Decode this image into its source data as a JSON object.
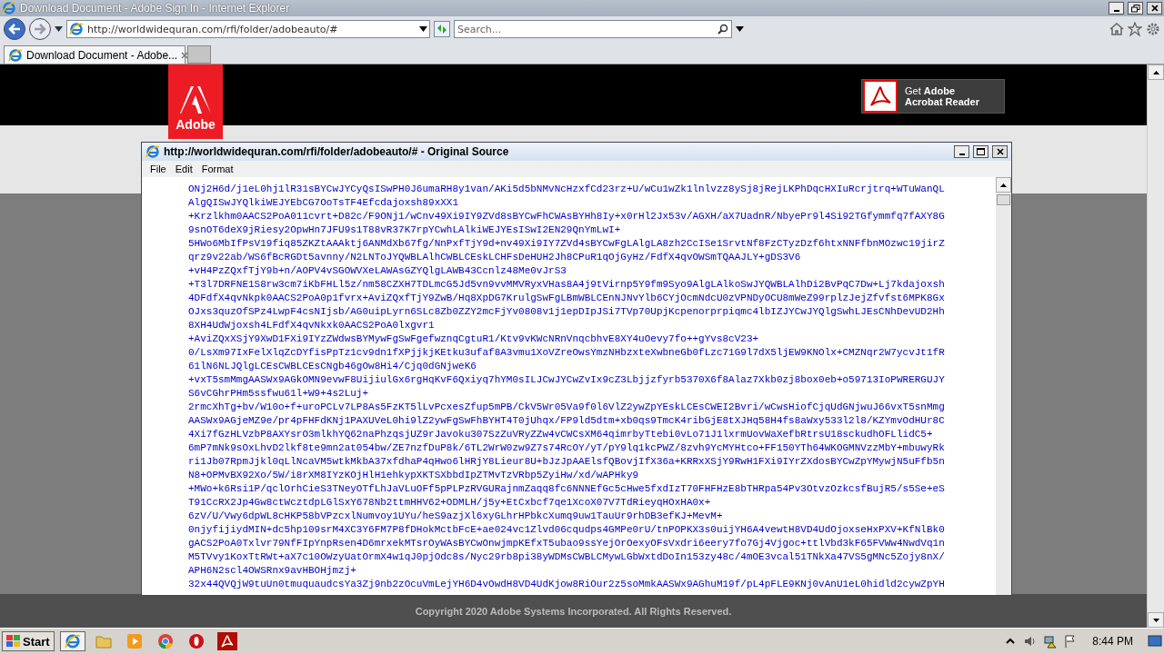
{
  "browser": {
    "title": "Download Document - Adobe Sign In - Internet Explorer",
    "address": "http://worldwidequran.com/rfi/folder/adobeauto/#",
    "search_placeholder": "Search...",
    "tabs": [
      {
        "label": "Download Document - Adobe...",
        "selected": true
      }
    ]
  },
  "page": {
    "logo": "Adobe",
    "reader_button": {
      "line1": "Get **Adobe**",
      "line2": "Acrobat Reader"
    },
    "copyright": "Copyright 2020 Adobe Systems Incorporated. All Rights Reserved."
  },
  "source_window": {
    "title": "http://worldwidequran.com/rfi/folder/adobeauto/# - Original Source",
    "menu": [
      "File",
      "Edit",
      "Format"
    ],
    "lines": [
      "ONj2H6d/j1eL0hj1lR31sBYCwJYCyQsISwPH0J6umaRH8y1van/AKi5d5bNMvNcHzxfCd23rz+U/wCu1wZk1lnlvzz8ySj8jRejLKPhDqcHXIuRcrjtrq+WTuWanQL",
      "AlgQISwJYQlkiWEJYEbCG7OoTsTF4Efcdajoxsh89xXX1",
      "+Krzlkhm0AACS2PoA011cvrt+D82c/F9ONj1/wCnv49Xi9IY9ZVd8sBYCwFhCWAsBYHh8Iy+x0rHl2Jx53v/AGXH/aX7UadnR/NbyePr9l4Si92TGfymmfq7fAXY8G",
      "9snOT6deX9jRiesy2OpwHn7JFU9s1T88vR37K7rpYCwhLAlkiWEJYEsISwI2EN29QnYmLwI+",
      "5HWo6MbIfPsV19fiq85ZKZtAAAktj6ANMdXb67fg/NnPxfTjY9d+nv49Xi9IY7ZVd4sBYCwFgLAlgLA8zh2CcISe1SrvtNf8FzCTyzDzf6htxNNFfbnMOzwc19jirZ",
      "qrz9v22ab/WS6fBcRGDt5avnny/N2LNToJYQWBLAlhCWBLCEskLCHFsDeHUH2Jh8CPuR1qOjGyHz/FdfX4qvOWSmTQAAJLY+gDS3V6",
      "+vH4PzZQxfTjY9b+n/AOPV4vSGOWVXeLAWAsGZYQlgLAWB43Ccnlz48Me0vJrS3",
      "+T3l7DRFNE1S8rw3cm7iKbFHLl5z/nm58CZXH7TDLmcG5Jd5vn9vvMMVRyxVHas8A4j9tVirnp5Y9fm9Syo9AlgLAlkoSwJYQWBLAlhDi2BvPqC7Dw+Lj7kdajoxsh",
      "4DFdfX4qvNkpk0AACS2PoA0p1fvrx+AviZQxfTjY9ZwB/Hq8XpDG7KrulgSwFgLBmWBLCEnNJNvYlb6CYjOcmNdcU0zVPNDyOCU8mWeZ99rplzJejZfvfst6MPK8Gx",
      "OJxs3quzOfSPz4LwpF4csNIjsb/AG0uipLyrn6SLc8Zb0ZZY2mcFjYv0808v1j1epDIpJSi7TVp70UpjKcpenorprpiqmc4lbIZJYCwJYQlgSwhLJEsCNhDevUD2Hh",
      "8XH4UdWjoxsh4LFdfX4qvNkxk0AACS2PoA0lxgvr1",
      "+AviZQxXSjY9XwD1FXi9IYzZWdwsBYMywFgSwFgefwznqCgtuR1/Ktv9vKWcNRnVnqcbhvE8XY4uOevy7fo++gYvs8cV23+",
      "0/LsXm97IxFelXlqZcDYfisPpTz1cv9dn1fXPjjkjKEtku3ufaf8A3vmu1XoVZreOwsYmzNHbzxteXwbneGb0fLzc71G9l7dX5ljEW9KNOlx+CMZNqr2W7ycvJt1fR",
      "61lN6NLJQlgLCEsCWBLCEsCNgb46gOw8Hi4/Cjq0dGNjweK6",
      "+vxT5smMmgAASWx9AGkOMN9evwF8UijiulGx6rgHqKvF6Qxiyq7hYM0sILJCwJYCwZvIx9cZ3Lbjjzfyrb5370X6f8Alaz7Xkb0zj8box0eb+o59713IoPWRERGUJY",
      "S6vCGhrPHm5ssfwu61l+W9+4s2Luj+",
      "2rmcXhTg+bv/W10o+f+uroPCLv7LP8As5FzKT5lLvPcxesZfup5mPB/CkV5Wr05Va9f0l6VlZ2ywZpYEskLCEsCWEI2Bvri/wCwsHiofCjqUdGNjwuJ66vxT5snMmg",
      "AASWx9AGjeMZ9e/pr4pFHFdKNj1PAXUVeL0hi9lZ2ywFgSwFhBYHT4T0jUhqx/FP9ld5dtm+xb0qs9TmcK4ribGjE8tXJHq58H4fs8aWxy533l2l8/KZYmvOdHUr8C",
      "4Xi7fGzHLVzbP8AXYsrO3mlkhYQ62naPhzqsjUZ9rJavoku307SzZuVRyZZw4vCWCsXM64qimrbyTtebi0vLo71J1lxrmUovWaXefbRtrsU18sckudhOFLlidC5+",
      "6mP7mNk9sOxLhvD2lkf8te9mn2at054bw/ZE7nzfDuP8k/6TL2WrW0zw9Z7s74RcOY/yT/pY9lq1kcPWZ/8zvh9YcMYHtco+FF150YTh64WKOGMNVzzMbY+mbuwyRk",
      "ri1Jb07RpmJjkl0qLlNcaVM5wtkMkbA37xfdhaP4qHwo6lHRjY8Lieur8U+bJzJpAAElsfQBovjIfX36a+KRRxXSjY9RwH1FXi9IYrZXdosBYCwZpYMywjN5uFfb5n",
      "N8+OPMvBX92Xo/5W/i8rXM8IYzKOjHlH1ehkypXKTSXbbdIpZTMvTzVRbp5ZyiHw/xd/wAPHky9",
      "+MWo+k6Rsi1P/qclOrhCieS3TNeyOTfLhJaVLuOFf5pPLPzRVGURajnmZaqq8fc6NNNEfGc5cHwe5fxdIzT70FHFHzE8bTHRpa54Pv3OtvzOzkcsfBujR5/s5Se+eS",
      "T91CcRX2Jp4Gw8ctWcztdpLGlSxY678Nb2ttmHHV62+ODMLH/j5y+EtCxbcf7qe1XcoX07V7TdRieyqHOxHA0x+",
      "6zV/U/Vwy6dpWL8cHKP58bVPzcxlNumvoy1UYu/heS9azjXl6xyGLhrHPbkcXumq9uw1TauUr9rhDB3efKJ+MevM+",
      "0njyfijiydMIN+dc5hp109srM4XC3Y6FM7P8fDHokMctbFcE+ae024vc1Zlvd06cqudps4GMPe0rU/tnPOPKX3s0uijYH6A4vewtH8VD4UdOjoxseHxPXV+KfNlBk0",
      "gACS2PoA0Txlvr79NfFIpYnpRsen4D6mrxekMTsrOyWAsBYCwOnwjmpKEfxT5ubao9ssYejOrOexyOFsVxdri6eery7fo7Gj4Vjgoc+ttlVbd3kF65FVWw4NwdVq1n",
      "M5TVvy1KoxTtRWt+aX7c10OWzyUatOrmX4w1qJ0pjOdc8s/Nyc29rb8pi38yWDMsCWBLCMywLGbWxtdDoIn153zy48c/4mOE3vcal51TNkXa47VS5gMNc5Zojy8nX/",
      "APH6N2scl4OWSRnx9avHBOHjmzj+",
      "32x44QVQjW9tuUn0tmuquaudcsYa3Zj9nb2zOcuVmLejYH6D4vOwdH8VD4UdKjow8RiOur2z5soMmkAASWx9AGhuM19f/pL4pFLE9KNj0vAnU1eL0hidld2cywZpYH"
    ]
  },
  "taskbar": {
    "start": "Start",
    "apps": [
      {
        "kind": "ie",
        "selected": true
      },
      {
        "kind": "folder",
        "selected": false
      },
      {
        "kind": "media",
        "selected": false
      },
      {
        "kind": "chrome",
        "selected": false
      },
      {
        "kind": "opera",
        "selected": false
      },
      {
        "kind": "acrobat",
        "selected": false
      }
    ],
    "clock": "8:44 PM"
  }
}
